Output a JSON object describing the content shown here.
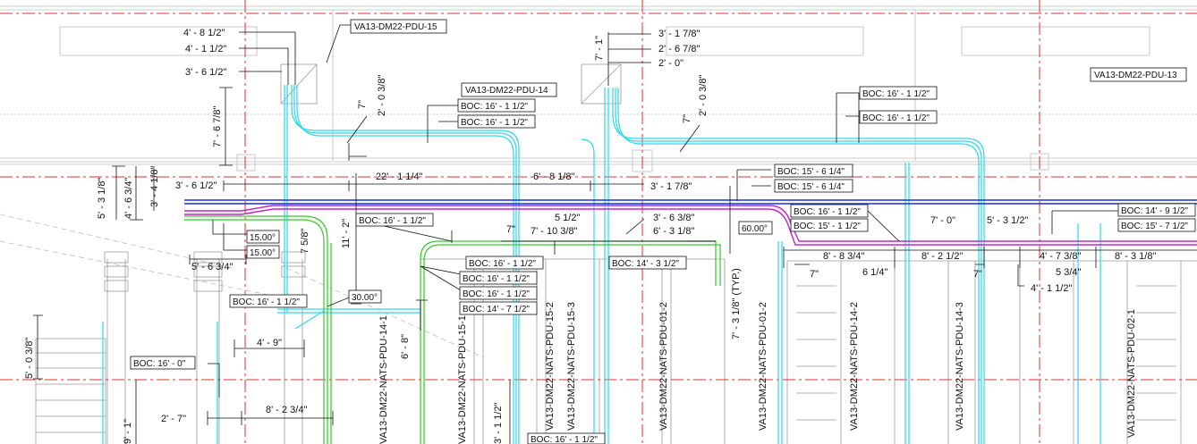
{
  "colors": {
    "grid_line": "#e03030",
    "conduit_cyan": "#2fd7ea",
    "conduit_green": "#35c92a",
    "conduit_magenta": "#c326c6",
    "conduit_blue": "#1b2fd8",
    "linework": "#111111"
  },
  "equipment_tags": [
    "VA13-DM22-PDU-15",
    "VA13-DM22-PDU-14",
    "VA13-DM22-PDU-13"
  ],
  "boc_tags": [
    "BOC: 16' - 1 1/2\"",
    "BOC: 16' - 1 1/2\"",
    "BOC: 16' - 1 1/2\"",
    "BOC: 16' - 1 1/2\"",
    "BOC: 15' - 6 1/4\"",
    "BOC: 15' - 6 1/4\"",
    "BOC: 16' - 1 1/2\"",
    "BOC: 15' - 1 1/2\"",
    "BOC: 14' - 9 1/2\"",
    "BOC: 15' - 7 1/2\"",
    "BOC: 16' - 1 1/2\"",
    "BOC: 16' - 1 1/2\"",
    "BOC: 14' - 3 1/2\"",
    "BOC: 16' - 1 1/2\"",
    "BOC: 16' - 1 1/2\"",
    "BOC: 14' - 7 1/2\"",
    "BOC: 16' - 1 1/2\"",
    "BOC: 16' - 0\"",
    "BOC: 16' - 1 1/2\""
  ],
  "angle_tags": [
    "15.00°",
    "15.00°",
    "30.00°",
    "60.00°"
  ],
  "dimensions": [
    "4' - 8 1/2\"",
    "4' - 1 1/2\"",
    "3' - 6 1/2\"",
    "3' - 1 7/8\"",
    "2' - 6 7/8\"",
    "2' - 0\"",
    "7' - 1\"",
    "7' - 6 7/8\"",
    "7\"",
    "2' - 0 3/8\"",
    "7\"",
    "2' - 0 3/8\"",
    "5' - 3 1/8\"",
    "4' - 6 3/4\"",
    "3' - 4 1/8\"",
    "3' - 6 1/2\"",
    "22' - 1 1/4\"",
    "6' - 8 1/8\"",
    "3' - 1 7/8\"",
    "11' - 2\"",
    "7 5/8\"",
    "5' - 6 3/4\"",
    "7\"",
    "7' - 10 3/8\"",
    "5 1/2\"",
    "3' - 6 3/8\"",
    "6' - 3 1/8\"",
    "7' - 3 1/8\" (TYP.)",
    "7' - 0\"",
    "5' - 3 1/2\"",
    "8' - 8 3/4\"",
    "8' - 2 1/2\"",
    "4' - 7 3/8\"",
    "8' - 3 1/8\"",
    "7\"",
    "6 1/4\"",
    "7\"",
    "5 3/4\"",
    "4' - 1 1/2\"",
    "4' - 9\"",
    "6' - 8\"",
    "5' - 0 3/8\"",
    "2' - 7\"",
    "8' - 2 3/4\"",
    "9' - 1\"",
    "3' - 1 1/2\""
  ],
  "circuit_labels": [
    "VA13-DM22-NATS-PDU-14-1",
    "VA13-DM22-NATS-PDU-15-1",
    "VA13-DM22-NATS-PDU-15-2",
    "VA13-DM22-NATS-PDU-15-3",
    "VA13-DM22-NATS-PDU-01-2",
    "VA13-DM22-NATS-PDU-01-2",
    "VA13-DM22-NATS-PDU-14-2",
    "VA13-DM22-NATS-PDU-14-3",
    "VA13-DM22-NATS-PDU-02-1"
  ]
}
